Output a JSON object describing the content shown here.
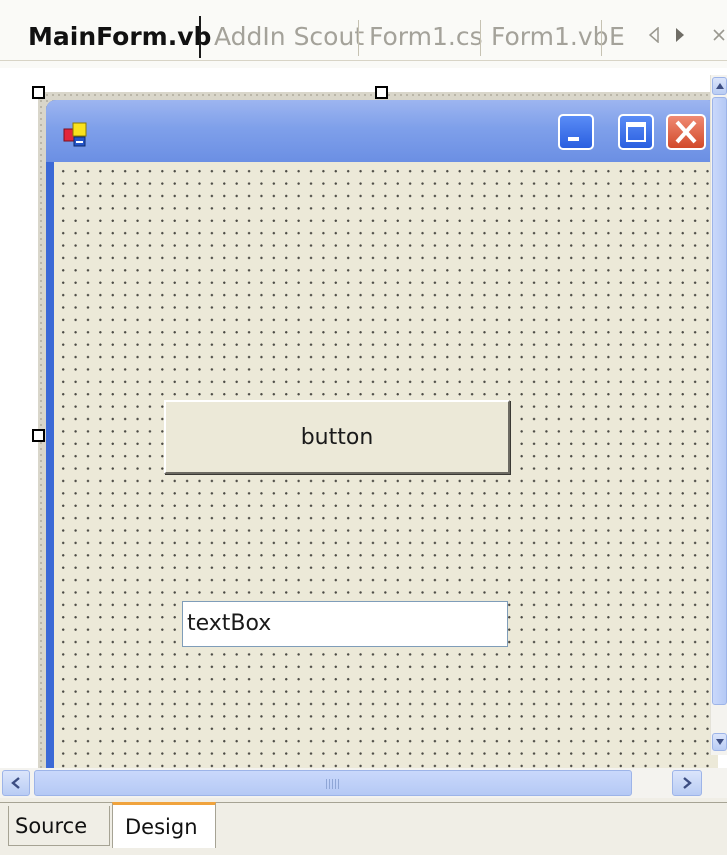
{
  "doc_tabs": {
    "active": "MainForm.vb",
    "tab2": "AddIn Scout",
    "tab3": "Form1.cs",
    "tab4": "Form1.vb",
    "tab5": "E",
    "icons": [
      "scroll-left-icon",
      "scroll-right-icon",
      "close-icon"
    ]
  },
  "form": {
    "icon": "form-icon",
    "window_buttons": [
      "minimize-icon",
      "maximize-icon",
      "close-icon"
    ],
    "button_text": "button",
    "textbox_text": "textBox"
  },
  "scrollbars": {
    "horizontal_arrows": [
      "chevron-left-icon",
      "chevron-right-icon"
    ],
    "vertical_arrows": [
      "chevron-up-icon",
      "chevron-down-icon"
    ]
  },
  "view_tabs": {
    "source": "Source",
    "design": "Design",
    "active": "Design"
  },
  "colors": {
    "titlebar": "#7fa0ea",
    "form_background": "#ece9d8",
    "close_button": "#e0533a",
    "active_tab_accent": "#f0a33d"
  }
}
